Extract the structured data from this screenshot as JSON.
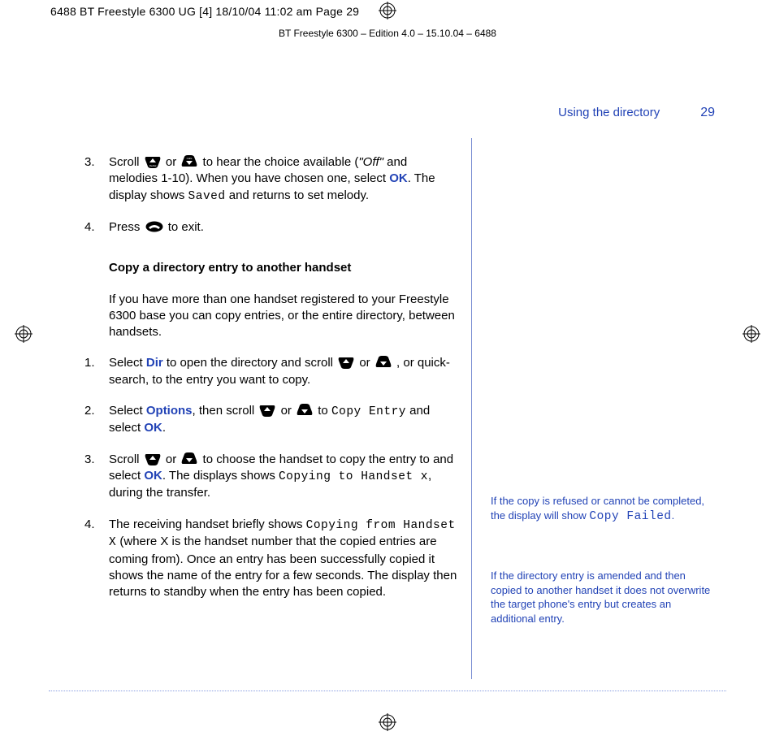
{
  "print_marks": {
    "header": "6488 BT Freestyle 6300 UG [4]  18/10/04  11:02 am  Page 29",
    "edition": "BT Freestyle 6300 – Edition 4.0 – 15.10.04 – 6488"
  },
  "header": {
    "section": "Using the directory",
    "page_number": "29"
  },
  "body": {
    "step3a": "Scroll ",
    "step3b": " or ",
    "step3c": " to hear the choice available (",
    "step3d": "\"Off\"",
    "step3e": " and melodies 1-10). When you have chosen one, select ",
    "step3ok": "OK",
    "step3f": ". The display shows ",
    "step3saved": "Saved",
    "step3g": " and returns to set melody.",
    "step4a": "Press ",
    "step4b": " to exit.",
    "copy_heading": "Copy a directory entry to another handset",
    "copy_intro": "If you have more than one handset registered to your Freestyle 6300 base you can copy entries, or the entire directory, between handsets.",
    "c1a": "Select ",
    "c1dir": "Dir",
    "c1b": " to open the directory and scroll ",
    "c1c": " or ",
    "c1d": " , or quick-search, to the entry you want to copy.",
    "c2a": "Select ",
    "c2opt": "Options",
    "c2b": ", then scroll ",
    "c2c": " or ",
    "c2d": " to ",
    "c2copy": "Copy Entry",
    "c2e": " and select ",
    "c2ok": "OK",
    "c2f": ".",
    "c3a": "Scroll ",
    "c3b": " or ",
    "c3c": " to choose the handset to copy the entry to and select ",
    "c3ok": "OK",
    "c3d": ". The displays shows ",
    "c3copyto": "Copying to Handset x",
    "c3e": ", during the transfer.",
    "c4a": "The receiving handset briefly shows ",
    "c4copyfrom": "Copying from Handset X",
    "c4b": " (where X is the handset number that the copied entries are coming from). Once an entry has been successfully copied it shows the name of the entry for a few seconds. The display then returns to standby when the entry has been copied."
  },
  "sidebar": {
    "note1a": "If the copy is refused or cannot be completed, the display will show ",
    "note1b": "Copy Failed",
    "note1c": ".",
    "note2": "If the directory entry is amended and then copied to another handset it does not overwrite the target phone's entry but creates an additional entry."
  }
}
